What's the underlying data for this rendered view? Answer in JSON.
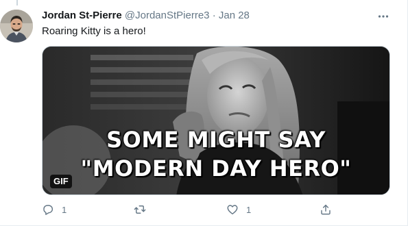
{
  "tweet": {
    "author": {
      "display_name": "Jordan St-Pierre",
      "handle": "@JordanStPierre3",
      "separator": "·",
      "date": "Jan 28"
    },
    "text": "Roaring Kitty is a hero!",
    "media": {
      "caption_line1": "SOME MIGHT SAY",
      "caption_line2": "\"MODERN DAY HERO\"",
      "badge": "GIF"
    },
    "actions": {
      "reply_count": "1",
      "like_count": "1"
    }
  },
  "icons": {
    "more": "more-horizontal-icon",
    "reply": "reply-icon",
    "retweet": "retweet-icon",
    "like": "heart-icon",
    "share": "share-icon"
  },
  "colors": {
    "text_primary": "#14171a",
    "text_secondary": "#657786",
    "border": "#ccd6dd"
  }
}
